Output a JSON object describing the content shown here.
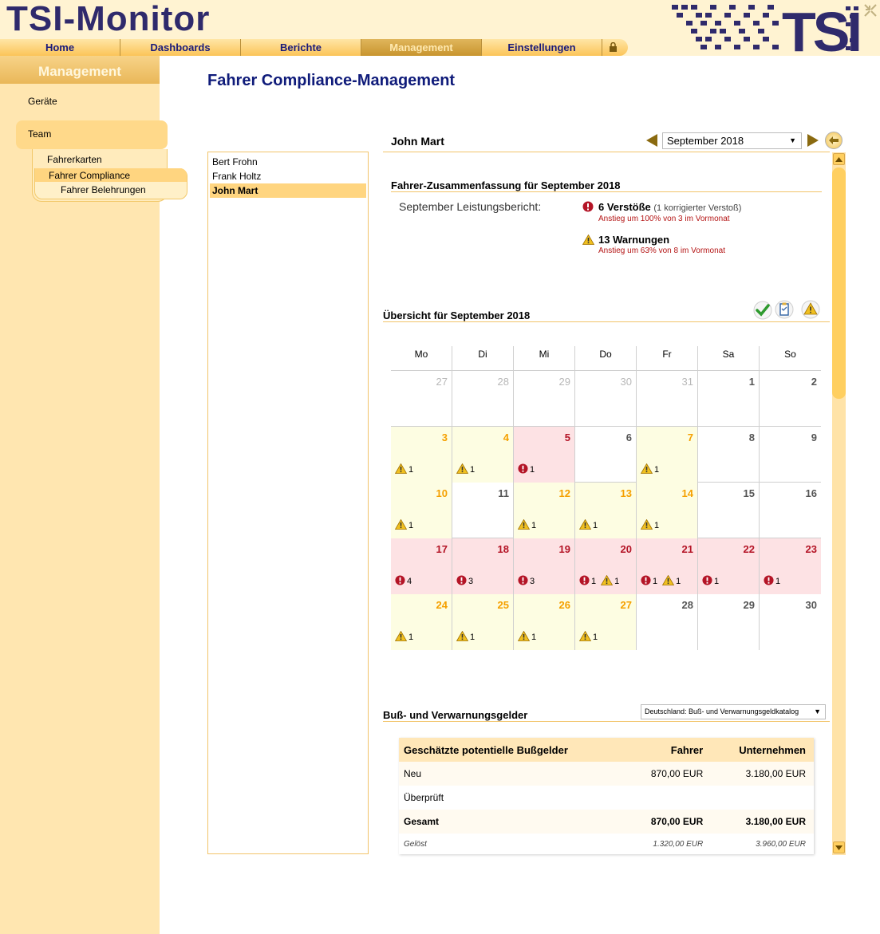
{
  "app": {
    "title": "TSI-Monitor",
    "logo_text": "TSI"
  },
  "nav": {
    "items": [
      {
        "label": "Home"
      },
      {
        "label": "Dashboards"
      },
      {
        "label": "Berichte"
      },
      {
        "label": "Management"
      },
      {
        "label": "Einstellungen"
      }
    ],
    "active": "Management"
  },
  "sidebar": {
    "heading": "Management",
    "items": {
      "geraete": "Geräte",
      "team": "Team",
      "fahrerkarten": "Fahrerkarten",
      "fahrer_compliance": "Fahrer Compliance",
      "fahrer_belehrungen": "Fahrer Belehrungen"
    }
  },
  "page": {
    "title": "Fahrer Compliance-Management"
  },
  "drivers": [
    "Bert Frohn",
    "Frank Holtz",
    "John Mart"
  ],
  "selected_driver": "John Mart",
  "month_select": {
    "value": "September 2018"
  },
  "summary": {
    "title": "Fahrer-Zusammenfassung für September 2018",
    "perf_label": "September Leistungsbericht:",
    "violations": "6 Verstöße",
    "violations_note": "(1 korrigierter Verstoß)",
    "violations_trend": "Anstieg um 100% von 3 im Vormonat",
    "warnings": "13 Warnungen",
    "warnings_trend": "Anstieg um 63% von 8 im Vormonat"
  },
  "overview": {
    "title": "Übersicht für September 2018"
  },
  "calendar": {
    "weekdays": [
      "Mo",
      "Di",
      "Mi",
      "Do",
      "Fr",
      "Sa",
      "So"
    ],
    "weeks": [
      [
        {
          "d": "27",
          "o": true
        },
        {
          "d": "28",
          "o": true
        },
        {
          "d": "29",
          "o": true
        },
        {
          "d": "30",
          "o": true
        },
        {
          "d": "31",
          "o": true
        },
        {
          "d": "1"
        },
        {
          "d": "2"
        }
      ],
      [
        {
          "d": "3",
          "s": "warn",
          "w": "1"
        },
        {
          "d": "4",
          "s": "warn",
          "w": "1"
        },
        {
          "d": "5",
          "s": "viol",
          "v": "1"
        },
        {
          "d": "6"
        },
        {
          "d": "7",
          "s": "warn",
          "w": "1"
        },
        {
          "d": "8"
        },
        {
          "d": "9"
        }
      ],
      [
        {
          "d": "10",
          "s": "warn",
          "w": "1"
        },
        {
          "d": "11"
        },
        {
          "d": "12",
          "s": "warn",
          "w": "1"
        },
        {
          "d": "13",
          "s": "warn",
          "w": "1"
        },
        {
          "d": "14",
          "s": "warn",
          "w": "1"
        },
        {
          "d": "15"
        },
        {
          "d": "16"
        }
      ],
      [
        {
          "d": "17",
          "s": "viol",
          "v": "4"
        },
        {
          "d": "18",
          "s": "viol",
          "v": "3"
        },
        {
          "d": "19",
          "s": "viol",
          "v": "3"
        },
        {
          "d": "20",
          "s": "viol",
          "v": "1",
          "w": "1"
        },
        {
          "d": "21",
          "s": "viol",
          "v": "1",
          "w": "1"
        },
        {
          "d": "22",
          "s": "viol",
          "v": "1"
        },
        {
          "d": "23",
          "s": "viol",
          "v": "1"
        }
      ],
      [
        {
          "d": "24",
          "s": "warn",
          "w": "1"
        },
        {
          "d": "25",
          "s": "warn",
          "w": "1"
        },
        {
          "d": "26",
          "s": "warn",
          "w": "1"
        },
        {
          "d": "27",
          "s": "warn",
          "w": "1"
        },
        {
          "d": "28"
        },
        {
          "d": "29"
        },
        {
          "d": "30"
        }
      ]
    ]
  },
  "fines": {
    "title": "Buß- und Verwarnungsgelder",
    "catalog_select": "Deutschland: Buß- und Verwarnungsgeldkatalog",
    "headers": [
      "Geschätzte potentielle Bußgelder",
      "Fahrer",
      "Unternehmen"
    ],
    "rows": [
      {
        "label": "Neu",
        "driver": "870,00 EUR",
        "company": "3.180,00 EUR"
      },
      {
        "label": "Überprüft",
        "driver": "",
        "company": ""
      },
      {
        "label": "Gesamt",
        "driver": "870,00 EUR",
        "company": "3.180,00 EUR"
      },
      {
        "label": "Gelöst",
        "driver": "1.320,00 EUR",
        "company": "3.960,00 EUR"
      }
    ]
  },
  "colors": {
    "brand": "#2f2a6c",
    "accent": "#ffd580",
    "violation": "#b41426",
    "warning": "#f5a000"
  }
}
